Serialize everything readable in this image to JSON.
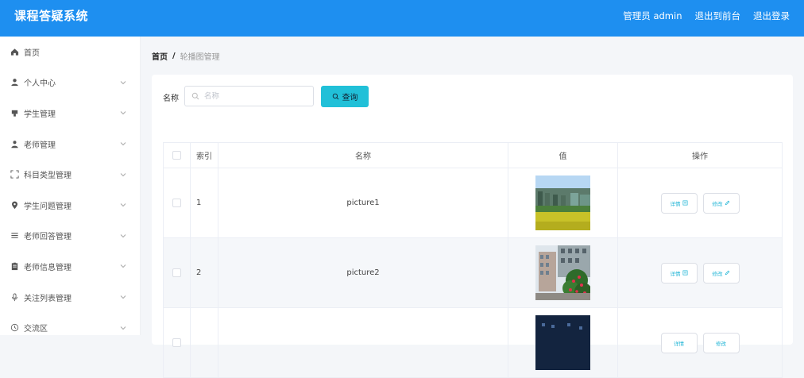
{
  "header": {
    "title": "课程答疑系统",
    "admin_label": "管理员 admin",
    "frontend_label": "退出到前台",
    "logout_label": "退出登录"
  },
  "sidebar": {
    "items": [
      {
        "label": "首页",
        "icon": "home-icon"
      },
      {
        "label": "个人中心",
        "icon": "user-icon"
      },
      {
        "label": "学生管理",
        "icon": "student-icon"
      },
      {
        "label": "老师管理",
        "icon": "teacher-icon"
      },
      {
        "label": "科目类型管理",
        "icon": "frame-icon"
      },
      {
        "label": "学生问题管理",
        "icon": "location-icon"
      },
      {
        "label": "老师回答管理",
        "icon": "list-icon"
      },
      {
        "label": "老师信息管理",
        "icon": "clipboard-icon"
      },
      {
        "label": "关注列表管理",
        "icon": "microphone-icon"
      },
      {
        "label": "交流区",
        "icon": "clock-icon"
      }
    ]
  },
  "breadcrumb": {
    "home": "首页",
    "separator": "/",
    "current": "轮播图管理"
  },
  "search": {
    "label": "名称",
    "placeholder": "名称",
    "value": "",
    "button_label": "查询"
  },
  "table": {
    "headers": {
      "index": "索引",
      "name": "名称",
      "value": "值",
      "actions": "操作"
    },
    "rows": [
      {
        "index": "1",
        "name": "picture1",
        "image": "campus-building-field"
      },
      {
        "index": "2",
        "name": "picture2",
        "image": "campus-building-flowers"
      },
      {
        "index": "",
        "name": "",
        "image": "campus-night"
      }
    ],
    "detail_label": "详情",
    "edit_label": "修改"
  },
  "colors": {
    "header_bg": "#1e8ff0",
    "accent": "#21c0d8",
    "link": "#21b5d6"
  }
}
